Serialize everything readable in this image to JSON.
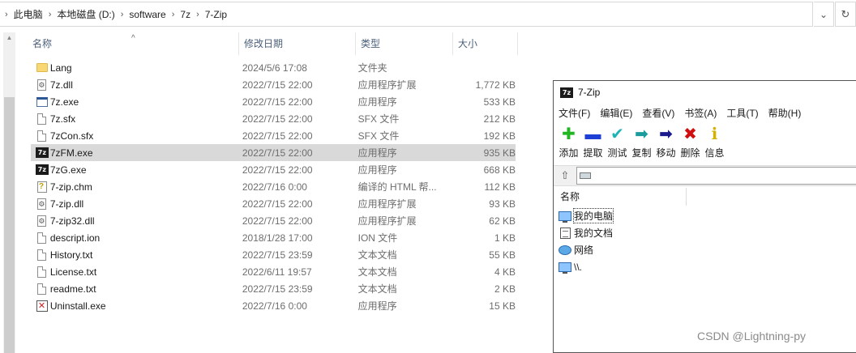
{
  "breadcrumb": [
    "此电脑",
    "本地磁盘 (D:)",
    "software",
    "7z",
    "7-Zip"
  ],
  "columns": {
    "name": "名称",
    "date": "修改日期",
    "type": "类型",
    "size": "大小"
  },
  "files": [
    {
      "name": "Lang",
      "date": "2024/5/6 17:08",
      "type": "文件夹",
      "size": "",
      "icon": "folder-icon"
    },
    {
      "name": "7z.dll",
      "date": "2022/7/15 22:00",
      "type": "应用程序扩展",
      "size": "1,772 KB",
      "icon": "dll-icon"
    },
    {
      "name": "7z.exe",
      "date": "2022/7/15 22:00",
      "type": "应用程序",
      "size": "533 KB",
      "icon": "exe-icon"
    },
    {
      "name": "7z.sfx",
      "date": "2022/7/15 22:00",
      "type": "SFX 文件",
      "size": "212 KB",
      "icon": "file-icon"
    },
    {
      "name": "7zCon.sfx",
      "date": "2022/7/15 22:00",
      "type": "SFX 文件",
      "size": "192 KB",
      "icon": "file-icon"
    },
    {
      "name": "7zFM.exe",
      "date": "2022/7/15 22:00",
      "type": "应用程序",
      "size": "935 KB",
      "icon": "7zip-app-icon",
      "selected": true
    },
    {
      "name": "7zG.exe",
      "date": "2022/7/15 22:00",
      "type": "应用程序",
      "size": "668 KB",
      "icon": "7zip-app-icon"
    },
    {
      "name": "7-zip.chm",
      "date": "2022/7/16 0:00",
      "type": "编译的 HTML 帮...",
      "size": "112 KB",
      "icon": "help-icon"
    },
    {
      "name": "7-zip.dll",
      "date": "2022/7/15 22:00",
      "type": "应用程序扩展",
      "size": "93 KB",
      "icon": "dll-icon"
    },
    {
      "name": "7-zip32.dll",
      "date": "2022/7/15 22:00",
      "type": "应用程序扩展",
      "size": "62 KB",
      "icon": "dll-icon"
    },
    {
      "name": "descript.ion",
      "date": "2018/1/28 17:00",
      "type": "ION 文件",
      "size": "1 KB",
      "icon": "file-icon"
    },
    {
      "name": "History.txt",
      "date": "2022/7/15 23:59",
      "type": "文本文档",
      "size": "55 KB",
      "icon": "file-icon"
    },
    {
      "name": "License.txt",
      "date": "2022/6/11 19:57",
      "type": "文本文档",
      "size": "4 KB",
      "icon": "file-icon"
    },
    {
      "name": "readme.txt",
      "date": "2022/7/15 23:59",
      "type": "文本文档",
      "size": "2 KB",
      "icon": "file-icon"
    },
    {
      "name": "Uninstall.exe",
      "date": "2022/7/16 0:00",
      "type": "应用程序",
      "size": "15 KB",
      "icon": "uninstall-icon"
    }
  ],
  "zip_window": {
    "title": "7-Zip",
    "menu": [
      "文件(F)",
      "编辑(E)",
      "查看(V)",
      "书签(A)",
      "工具(T)",
      "帮助(H)"
    ],
    "toolbar": [
      {
        "label": "添加",
        "icon": "add-icon",
        "color": "#22b522"
      },
      {
        "label": "提取",
        "icon": "extract-icon",
        "color": "#1e3fd4"
      },
      {
        "label": "测试",
        "icon": "test-icon",
        "color": "#21b3b3"
      },
      {
        "label": "复制",
        "icon": "copy-icon",
        "color": "#1a9c9c"
      },
      {
        "label": "移动",
        "icon": "move-icon",
        "color": "#1a1a8c"
      },
      {
        "label": "删除",
        "icon": "delete-icon",
        "color": "#d01010"
      },
      {
        "label": "信息",
        "icon": "info-icon",
        "color": "#d4b000"
      }
    ],
    "list_header": "名称",
    "items": [
      {
        "label": "我的电脑",
        "icon": "computer-icon"
      },
      {
        "label": "我的文档",
        "icon": "documents-icon"
      },
      {
        "label": "网络",
        "icon": "network-icon"
      },
      {
        "label": "\\\\.",
        "icon": "computer-icon"
      }
    ]
  },
  "watermark": "CSDN @Lightning-py"
}
